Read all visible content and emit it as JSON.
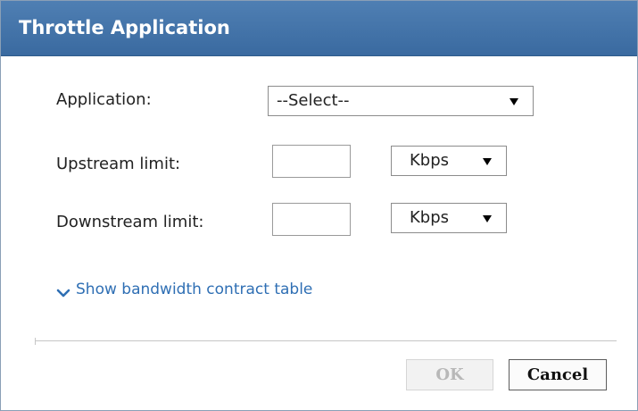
{
  "dialog": {
    "title": "Throttle Application",
    "title_bar_color": "#3f70a8"
  },
  "form": {
    "application": {
      "label": "Application:",
      "selected": "--Select--"
    },
    "upstream": {
      "label": "Upstream limit:",
      "value": "",
      "unit": "Kbps"
    },
    "downstream": {
      "label": "Downstream limit:",
      "value": "",
      "unit": "Kbps"
    }
  },
  "link": {
    "label": "Show bandwidth contract table",
    "icon": "chevron-down-icon",
    "color": "#2f6fb4"
  },
  "buttons": {
    "ok": {
      "label": "OK",
      "enabled": false
    },
    "cancel": {
      "label": "Cancel",
      "enabled": true
    }
  }
}
